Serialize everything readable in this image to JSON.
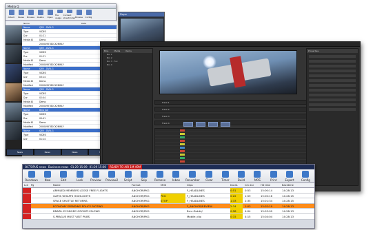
{
  "win1": {
    "title": "Media Q",
    "toolbar": [
      "Attach",
      "Pause",
      "Browse",
      "Delete",
      "Open",
      "File usage",
      "Context sheet/index",
      "Browse",
      "Config"
    ],
    "cols": [
      "Name",
      "Date"
    ],
    "rows": [
      [
        "Name",
        "QER - DVN-G"
      ],
      [
        "Type",
        "VIDEO"
      ],
      [
        "Dur",
        "01:21"
      ],
      [
        "Media ID",
        "Demo"
      ],
      [
        "",
        "2000495782CX2NWLY"
      ],
      [
        "Name",
        "QER - DVN-G"
      ],
      [
        "Type",
        "VIDEO"
      ],
      [
        "Dur",
        "01:21"
      ],
      [
        "Media ID",
        "Demo"
      ],
      [
        "Modified",
        "2000495782CX2NWLY"
      ],
      [
        "Name",
        "QER - DVN-G"
      ],
      [
        "Type",
        "VIDEO"
      ],
      [
        "Dur",
        "03:14"
      ],
      [
        "Media ID",
        "Demo"
      ],
      [
        "Modified",
        "2000495782CX2NWLY"
      ],
      [
        "Name",
        "QER - DVN-G"
      ],
      [
        "Type",
        "VIDEO"
      ],
      [
        "Dur",
        "02:04"
      ],
      [
        "Media ID",
        "Demo"
      ],
      [
        "Modified",
        "2000495782CX2NWLY"
      ],
      [
        "Name",
        "Bina Jud"
      ],
      [
        "Type",
        "VIDEO"
      ],
      [
        "Dur",
        "00:41"
      ],
      [
        "Media ID",
        "Demo"
      ],
      [
        "Modified",
        "2000495782CX2NWLY"
      ],
      [
        "Name",
        "QER - DVN-G"
      ],
      [
        "Type",
        "VIDEO"
      ],
      [
        "Dur",
        "01:14"
      ]
    ],
    "player_title": "Player",
    "bottom": [
      "News",
      "News",
      "News",
      "News"
    ]
  },
  "win2": {
    "panel_tabs": [
      "Bins",
      "Media",
      "Items"
    ],
    "bins": [
      "Bin 1",
      "Bin 2",
      "Bin 3 · Fox",
      "Bin 4"
    ],
    "tracks": [
      "Track 1",
      "Track 2",
      "Track 3",
      "Track 4"
    ],
    "props_title": "Properties"
  },
  "win3": {
    "title_parts": [
      "OCTOPUS news",
      "Business news",
      "01:29 15:09",
      "01:29 15:00"
    ],
    "ready": "READY TO AIR 1M 49M",
    "toolbar": [
      "Rundown",
      "New",
      "Edit",
      "Lock",
      "Preview",
      "Preview2",
      "Script",
      "Skip",
      "Remove",
      "Inbox",
      "Renumber",
      "Clear",
      "Timer",
      "Build",
      "MOS",
      "Print",
      "Export",
      "Config"
    ],
    "headers": [
      "Lck",
      "Pg",
      "Name",
      "Format",
      "MOS",
      "Clips",
      "Durat.",
      "Cm dur",
      "Hit time",
      "Backtime"
    ],
    "rows": [
      {
        "name": "ARMILED MEMBERS LOOSE FREE FLIGHTS",
        "format": "ANCHOR/PKG",
        "mos": "",
        "clip": "F_HEADLINES",
        "dur": "0:51",
        "cm": "0:53",
        "hit": "15:00:14",
        "back": "14:28:13"
      },
      {
        "name": "GAFFA WHAFFS HIGHLIGHTS",
        "format": "ANCHOR/PKG",
        "mos": "PKG",
        "clip": "F_HEADLINES",
        "dur": "0:22",
        "cm": "1:59",
        "hit": "15:00:16",
        "back": "14:28:15"
      },
      {
        "name": "SPACE SHUTTLE RETURNS",
        "format": "ANCHOR/PKG",
        "mos": "STOP",
        "clip": "F_HEADLINES",
        "dur": "1:33",
        "cm": "2:35",
        "hit": "15:01:34",
        "back": "14:28:15"
      },
      {
        "name": "ECONOMY SPENDING POLICY RIOTING",
        "format": "ANCHOR/PKG",
        "mos": "",
        "clip": "F_ANCHOR/REVIEW",
        "dur": "2:34",
        "cm": "1:03",
        "hit": "15:02:19",
        "back": "14:28:13"
      },
      {
        "name": "BRAZIL ECONOMY GROWTH SLOWS",
        "format": "ANCHOR/PKG",
        "mos": "",
        "clip": "Brnc.Dstrkt/",
        "dur": "0:58",
        "cm": "4:04",
        "hit": "15:03:09",
        "back": "14:28:13"
      },
      {
        "name": "S.PRAGUE MUST VISIT PUBS",
        "format": "ANCHOR/PKG",
        "mos": "",
        "clip": "Mobile_clip",
        "dur": "0:15",
        "cm": "4:15",
        "hit": "15:04:04",
        "back": "14:28:13"
      }
    ]
  },
  "colors": {
    "rundown_header": "#1d2c55",
    "ready": "#c71919",
    "highlight": "#ff8c1a",
    "duration": "#f0d000"
  }
}
